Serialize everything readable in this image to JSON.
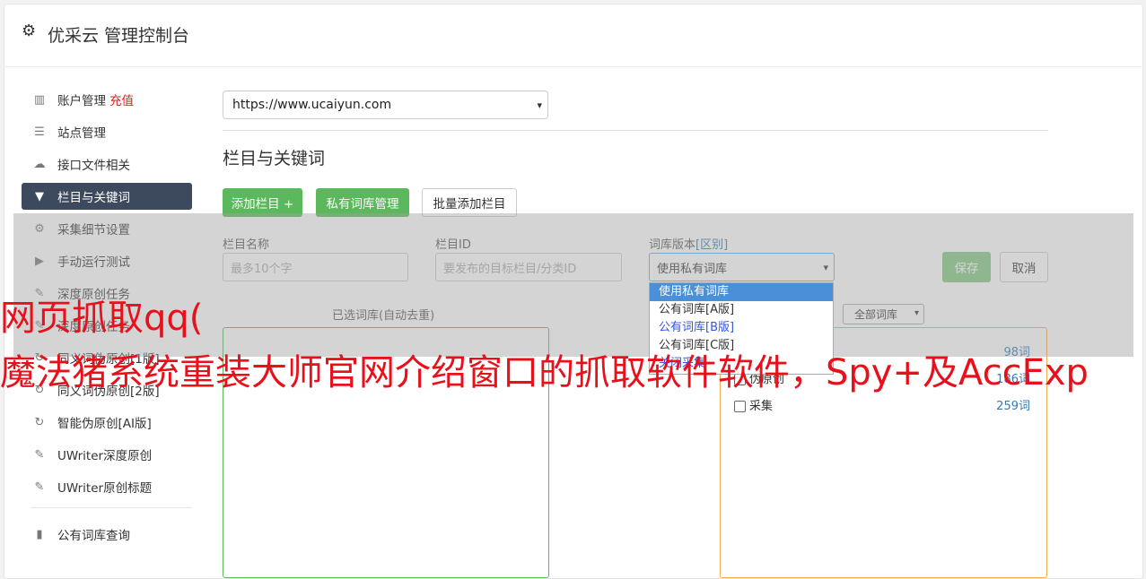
{
  "app": {
    "title": "优采云 管理控制台",
    "icon": "gear-icon"
  },
  "sidebar": {
    "items": [
      {
        "label": "账户管理",
        "badge": "充值",
        "icon": "bar-chart-icon"
      },
      {
        "label": "站点管理",
        "icon": "server-icon"
      },
      {
        "label": "接口文件相关",
        "icon": "cloud-upload-icon"
      },
      {
        "label": "栏目与关键词",
        "icon": "filter-icon",
        "active": true
      },
      {
        "label": "采集细节设置",
        "icon": "cogs-icon"
      },
      {
        "label": "手动运行测试",
        "icon": "play-circle-icon"
      },
      {
        "label": "深度原创任务",
        "icon": "edit-icon"
      },
      {
        "label": "深度原创任务",
        "icon": "edit-icon"
      },
      {
        "label": "同义词伪原创[1版]",
        "icon": "refresh-icon"
      },
      {
        "label": "同义词伪原创[2版]",
        "icon": "refresh-icon"
      },
      {
        "label": "智能伪原创[AI版]",
        "icon": "refresh-icon"
      },
      {
        "label": "UWriter深度原创",
        "icon": "edit-icon"
      },
      {
        "label": "UWriter原创标题",
        "icon": "edit-icon"
      }
    ],
    "lower_items": [
      {
        "label": "公有词库查询",
        "icon": "book-icon"
      }
    ]
  },
  "main": {
    "site_select": {
      "value": "https://www.ucaiyun.com"
    },
    "section_title": "栏目与关键词",
    "buttons": {
      "add_column": "添加栏目 +",
      "private_lib": "私有词库管理",
      "batch_add": "批量添加栏目"
    },
    "form": {
      "col_name_label": "栏目名称",
      "col_name_placeholder": "最多10个字",
      "col_id_label": "栏目ID",
      "col_id_placeholder": "要发布的目标栏目/分类ID",
      "lib_version_label": "词库版本",
      "lib_version_link": "[区别]",
      "lib_version_value": "使用私有词库",
      "save": "保存",
      "cancel": "取消"
    },
    "dropdown_options": [
      "使用私有词库",
      "公有词库[A版]",
      "公有词库[B版]",
      "公有词库[C版]",
      "关闭采集"
    ],
    "selected_libs_title": "已选词库(自动去重)",
    "filter_select": "全部词库",
    "libraries": [
      {
        "name": "",
        "count": "98词"
      },
      {
        "name": "伪原创",
        "count": "186词"
      },
      {
        "name": "采集",
        "count": "259词"
      }
    ]
  },
  "watermark": {
    "line1": "网页抓取qq(",
    "line2": "魔法猪系统重装大师官网介绍窗口的抓取软件软件，Spy+及AccExp"
  },
  "colors": {
    "accent_green": "#5cb85c",
    "active_nav": "#3d4a5d",
    "watermark": "#e8101a"
  }
}
